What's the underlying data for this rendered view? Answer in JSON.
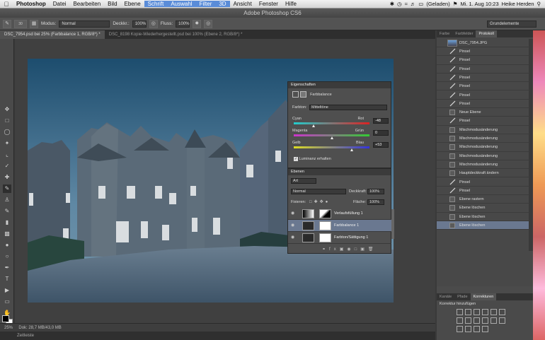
{
  "menubar": {
    "items": [
      "Photoshop",
      "Datei",
      "Bearbeiten",
      "Bild",
      "Ebene",
      "Schrift",
      "Auswahl",
      "Filter",
      "3D",
      "Ansicht",
      "Fenster",
      "Hilfe"
    ],
    "battery": "(Geladen)",
    "datetime": "Mi. 1. Aug 10:23",
    "user": "Heike Herden"
  },
  "window_title": "Adobe Photoshop CS6",
  "optbar": {
    "mode_label": "Modus:",
    "mode_value": "Normal",
    "opacity_label": "Deckkr.:",
    "opacity_value": "100%",
    "flow_label": "Fluss:",
    "flow_value": "100%",
    "brush_size": "30",
    "workspace": "Grundelemente"
  },
  "doc_tabs": [
    "DSC_7954.psd bei 25% (Farbbalance 1, RGB/8*) *",
    "DSC_8198 Kopie-Wiederhergestellt.psd bei 100% (Ebene 2, RGB/8*) *"
  ],
  "status": {
    "zoom": "25%",
    "doc": "Dok: 28,7 MB/43,0 MB",
    "timeline": "Zeitleiste"
  },
  "history_panel": {
    "tabs": [
      "Farbe",
      "Farbfelder",
      "Protokoll"
    ],
    "snapshot": "DSC_7954.JPG",
    "items": [
      "Pinsel",
      "Pinsel",
      "Pinsel",
      "Pinsel",
      "Pinsel",
      "Pinsel",
      "Pinsel",
      "Neue Ebene",
      "Pinsel",
      "Mischmodusänderung",
      "Mischmodusänderung",
      "Mischmodusänderung",
      "Mischmodusänderung",
      "Mischmodusänderung",
      "Hauptdeckkraft ändern",
      "Pinsel",
      "Pinsel",
      "Ebene rastern",
      "Ebene löschen",
      "Ebene löschen",
      "Ebene löschen"
    ],
    "selected_index": 20
  },
  "adjust_panel": {
    "tabs": [
      "Kanäle",
      "Pfade",
      "Korrekturen"
    ],
    "title": "Korrektur hinzufügen"
  },
  "properties": {
    "title": "Eigenschaften",
    "adj_name": "Farbbalance",
    "tone_label": "Farbton:",
    "tone_value": "Mitteltöne",
    "sliders": [
      {
        "left": "Cyan",
        "right": "Rot",
        "value": "-48",
        "level": -48
      },
      {
        "left": "Magenta",
        "right": "Grün",
        "value": "0",
        "level": 0
      },
      {
        "left": "Gelb",
        "right": "Blau",
        "value": "+53",
        "level": 53
      }
    ],
    "luminance": "Luminanz erhalten"
  },
  "layers": {
    "title": "Ebenen",
    "filter": "Art",
    "blend": "Normal",
    "opacity_label": "Deckkraft:",
    "opacity": "100%",
    "lock_label": "Fixieren:",
    "fill_label": "Fläche:",
    "fill": "100%",
    "rows": [
      "Verlaufsfüllung 1",
      "Farbbalance 1",
      "Farbton/Sättigung 1"
    ],
    "selected_index": 1
  },
  "colors": {
    "accent": "#6a7890",
    "highlight": "#5a8cd8"
  }
}
